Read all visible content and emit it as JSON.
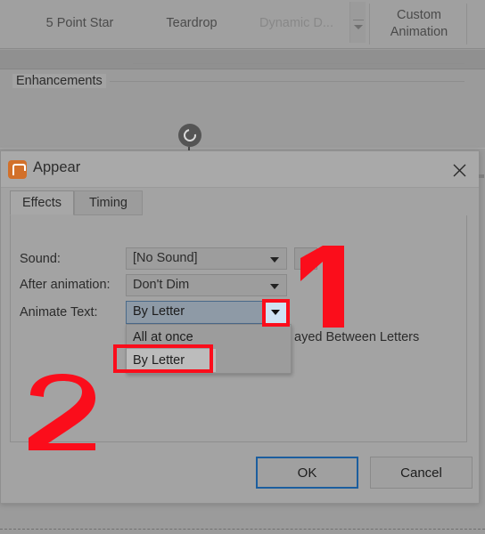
{
  "ribbon": {
    "gallery_items": [
      {
        "label": "5 Point Star",
        "state": "normal"
      },
      {
        "label": "Teardrop",
        "state": "normal"
      },
      {
        "label": "Dynamic D...",
        "state": "dimmed"
      }
    ],
    "scroll_more_icon": "chevron-down-icon",
    "custom_animation_label": "Custom\nAnimation"
  },
  "canvas": {
    "rotate_handle_icon": "rotate-icon"
  },
  "dialog": {
    "icon": "powerpoint-icon",
    "title": "Appear",
    "close_icon": "close-icon",
    "tabs": [
      {
        "label": "Effects",
        "active": true
      },
      {
        "label": "Timing",
        "active": false
      }
    ],
    "group": {
      "legend": "Enhancements",
      "rows": [
        {
          "label": "Sound:",
          "control": "combobox",
          "value": "[No Sound]",
          "arrow_icon": "chevron-down-icon",
          "extra_button_icon": "speaker-icon"
        },
        {
          "label": "After animation:",
          "control": "combobox",
          "value": "Don't Dim",
          "arrow_icon": "chevron-down-icon"
        },
        {
          "label": "Animate Text:",
          "control": "combobox",
          "value": "By Letter",
          "arrow_icon": "chevron-down-icon",
          "expanded": true
        }
      ],
      "dropdown_options": [
        {
          "label": "All at once",
          "selected": false
        },
        {
          "label": "By Letter",
          "selected": true
        }
      ],
      "obscured_text": "ayed Between Letters"
    },
    "buttons": {
      "ok": "OK",
      "cancel": "Cancel"
    }
  },
  "annotations": [
    {
      "id": "step-1",
      "label": "1",
      "color": "#fb0d1b"
    },
    {
      "id": "step-2",
      "label": "2",
      "color": "#fb0d1b"
    }
  ],
  "colors": {
    "annotation_red": "#fb0d1b",
    "focus_blue": "#1c5e9e",
    "selected_combo": "#8e9aa6",
    "combo_button": "#cfe2f3",
    "app_orange": "#d2702a",
    "dialog_bg": "#a3a3a3"
  }
}
